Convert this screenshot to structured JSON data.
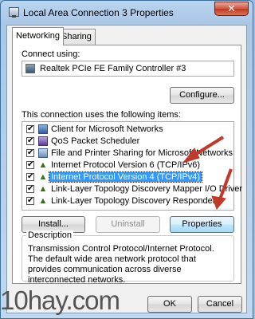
{
  "window": {
    "title": "Local Area Connection 3 Properties",
    "close_glyph": "✕"
  },
  "tabs": [
    {
      "label": "Networking",
      "active": true
    },
    {
      "label": "Sharing",
      "active": false
    }
  ],
  "connect_using_label": "Connect using:",
  "adapter_name": "Realtek PCIe FE Family Controller #3",
  "configure_label": "Configure...",
  "items_label": "This connection uses the following items:",
  "items": [
    {
      "label": "Client for Microsoft Networks",
      "checked": true,
      "icon": "network-client-icon"
    },
    {
      "label": "QoS Packet Scheduler",
      "checked": true,
      "icon": "qos-icon"
    },
    {
      "label": "File and Printer Sharing for Microsoft Networks",
      "checked": true,
      "icon": "file-sharing-icon"
    },
    {
      "label": "Internet Protocol Version 6 (TCP/IPv6)",
      "checked": true,
      "icon": "protocol-icon"
    },
    {
      "label": "Internet Protocol Version 4 (TCP/IPv4)",
      "checked": true,
      "icon": "protocol-icon",
      "selected": true
    },
    {
      "label": "Link-Layer Topology Discovery Mapper I/O Driver",
      "checked": true,
      "icon": "protocol-icon"
    },
    {
      "label": "Link-Layer Topology Discovery Responder",
      "checked": true,
      "icon": "protocol-icon"
    }
  ],
  "buttons": {
    "install": "Install...",
    "uninstall": "Uninstall",
    "properties": "Properties",
    "ok": "OK",
    "cancel": "Cancel"
  },
  "description": {
    "legend": "Description",
    "text": "Transmission Control Protocol/Internet Protocol. The default wide area network protocol that provides communication across diverse interconnected networks."
  },
  "watermark": "10hay.com",
  "colors": {
    "selection": "#3399ff",
    "arrow": "#c0392b"
  }
}
